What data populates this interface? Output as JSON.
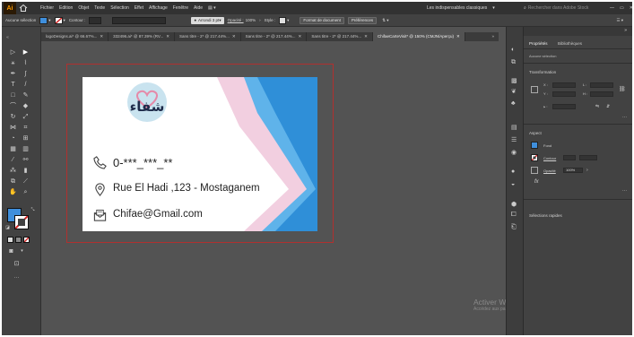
{
  "app": {
    "logo": "Ai"
  },
  "menu": {
    "items": [
      "Fichier",
      "Edition",
      "Objet",
      "Texte",
      "Sélection",
      "Effet",
      "Affichage",
      "Fenêtre",
      "Aide"
    ],
    "workspace": "Les indispensables classiques",
    "search_placeholder": "Rechercher dans Adobe Stock"
  },
  "control": {
    "selection_label": "Aucune sélection",
    "stroke_label": "Contour :",
    "brush_label": "Arrondi 3 pt",
    "opacity_label": "Opacité :",
    "opacity_value": "100%",
    "style_label": "Style :",
    "doc_format_button": "Format de document",
    "prefs_button": "Préférences",
    "fill_color": "#3f8fdc",
    "stroke_color": "#cc2d2d"
  },
  "tabs": [
    {
      "label": "logoDesigns.ai* @ 66.67%...",
      "active": false
    },
    {
      "label": "332496.ai* @ 87.39% (RV...",
      "active": false
    },
    {
      "label": "Sans titre - 2* @ 217.44%...",
      "active": false
    },
    {
      "label": "Sans titre - 2* @ 217.44%...",
      "active": false
    },
    {
      "label": "Sans titre - 2* @ 217.44%...",
      "active": false
    },
    {
      "label": "ChifaeCarteVisit* @ 150% (CMJN/Aperçu)",
      "active": true
    }
  ],
  "card": {
    "logo_text": "شفاء",
    "phone": "0-***_***_**",
    "address": "Rue El Hadi ,123 - Mostaganem",
    "email": "Chifae@Gmail.com",
    "colors": {
      "primary_blue": "#2f8fd8",
      "light_blue": "#5fb3ea",
      "pink": "#f2cfe0",
      "light_pink": "#f7e3ec"
    }
  },
  "panel": {
    "tab_properties": "Propriétés",
    "tab_library": "Bibliothèques",
    "no_selection": "Aucune sélection",
    "transform_title": "Transformation",
    "appearance_title": "Aspect",
    "fill_label": "Fond",
    "stroke_label": "Contour",
    "opacity_label": "Opacité",
    "opacity_value": "100%",
    "quick_actions": "Sélections rapides"
  },
  "watermark": {
    "title": "Activer Windows",
    "subtitle": "Accédez aux paramètres de l'ordinateur pour activer Windows."
  }
}
